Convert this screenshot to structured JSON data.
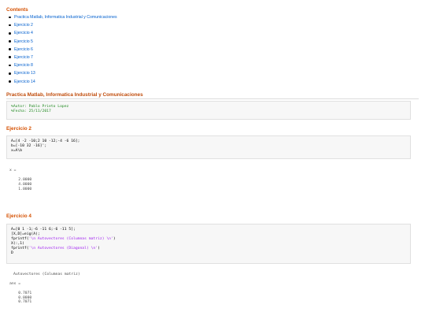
{
  "contents_heading": "Contents",
  "toc": [
    "Practica Matlab, Informatica Industrial y Comunicaciones",
    "Ejercicio 2",
    "Ejercicio 4",
    "Ejercicio 5",
    "Ejercicio 6",
    "Ejercicio 7",
    "Ejercicio 8",
    "Ejercicio 13",
    "Ejercicio 14"
  ],
  "section_title": "Practica Matlab, Informatica Industrial y Comunicaciones",
  "header_code": [
    "%Autor: Pablo Prieto Lopez",
    "%Fecha: 25/11/2017"
  ],
  "ej2": {
    "heading": "Ejercicio 2",
    "code": [
      "A=[4 -2 -10;2 10 -12;-4 -6 16];",
      "b=[-10 32 -16]';",
      "x=A\\b"
    ],
    "output_label": "x =",
    "output_values": [
      "2.0000",
      "4.0000",
      "1.0000"
    ]
  },
  "ej4": {
    "heading": "Ejercicio 4",
    "code_1": "A=[0 1 -1;-6 -11 6;-6 -11 5];",
    "code_2": "[X,D]=eig(A);",
    "code_3_fn": "fprintf(",
    "code_3_str": "'\\n Autovectores (Columnas matriz) \\n'",
    "code_3_end": ")",
    "code_4": "X(:,1)",
    "code_5_fn": "fprintf(",
    "code_5_str": "'\\n Autovectores (Diagonal) \\n'",
    "code_5_end": ")",
    "code_6": "D",
    "output_heading": "Autovectores (Columnas matriz)",
    "output_label": "ans =",
    "output_values": [
      "0.7071",
      "0.0000",
      "0.7071"
    ]
  }
}
